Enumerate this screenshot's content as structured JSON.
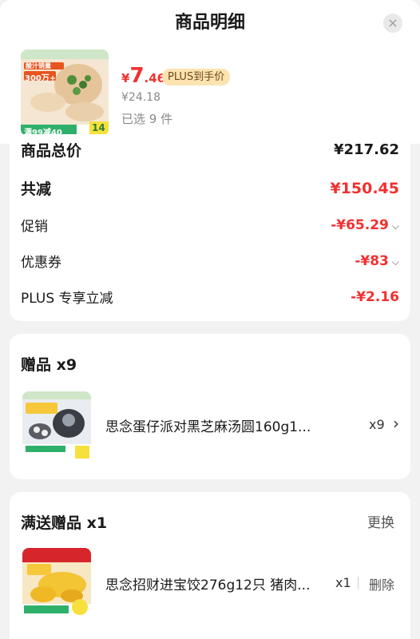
{
  "header": {
    "title": "商品明细",
    "close_icon": "×"
  },
  "product": {
    "image_overlay": {
      "badge_top": "酸汁销量",
      "badge_sales": "300万+",
      "badge_bottom": "满99减40",
      "badge_corner": "14"
    },
    "currency": "¥",
    "price_int": "7",
    "price_dec": ".46",
    "plus_badge": "PLUS到手价",
    "original_price": "¥24.18",
    "selected": "已选 9 件"
  },
  "summary": {
    "total_label": "商品总价",
    "total_value": "¥217.62",
    "reduce_label": "共减",
    "reduce_value": "¥150.45",
    "promo_label": "促销",
    "promo_value": "-¥65.29",
    "coupon_label": "优惠券",
    "coupon_value": "-¥83",
    "plus_label": "PLUS 专享立减",
    "plus_value": "-¥2.16"
  },
  "gift_card": {
    "title": "赠品 x9",
    "item_name": "思念蛋仔派对黑芝麻汤圆160g1...",
    "qty": "x9",
    "chevron": "›"
  },
  "full_gift_card": {
    "title": "满送赠品 x1",
    "replace": "更换",
    "item_name": "思念招财进宝饺276g12只 猪肉...",
    "qty": "x1",
    "delete": "删除"
  },
  "colors": {
    "accent_red": "#f23030",
    "plus_badge_bg": "#fde3b0",
    "background": "#f2f2f2"
  }
}
